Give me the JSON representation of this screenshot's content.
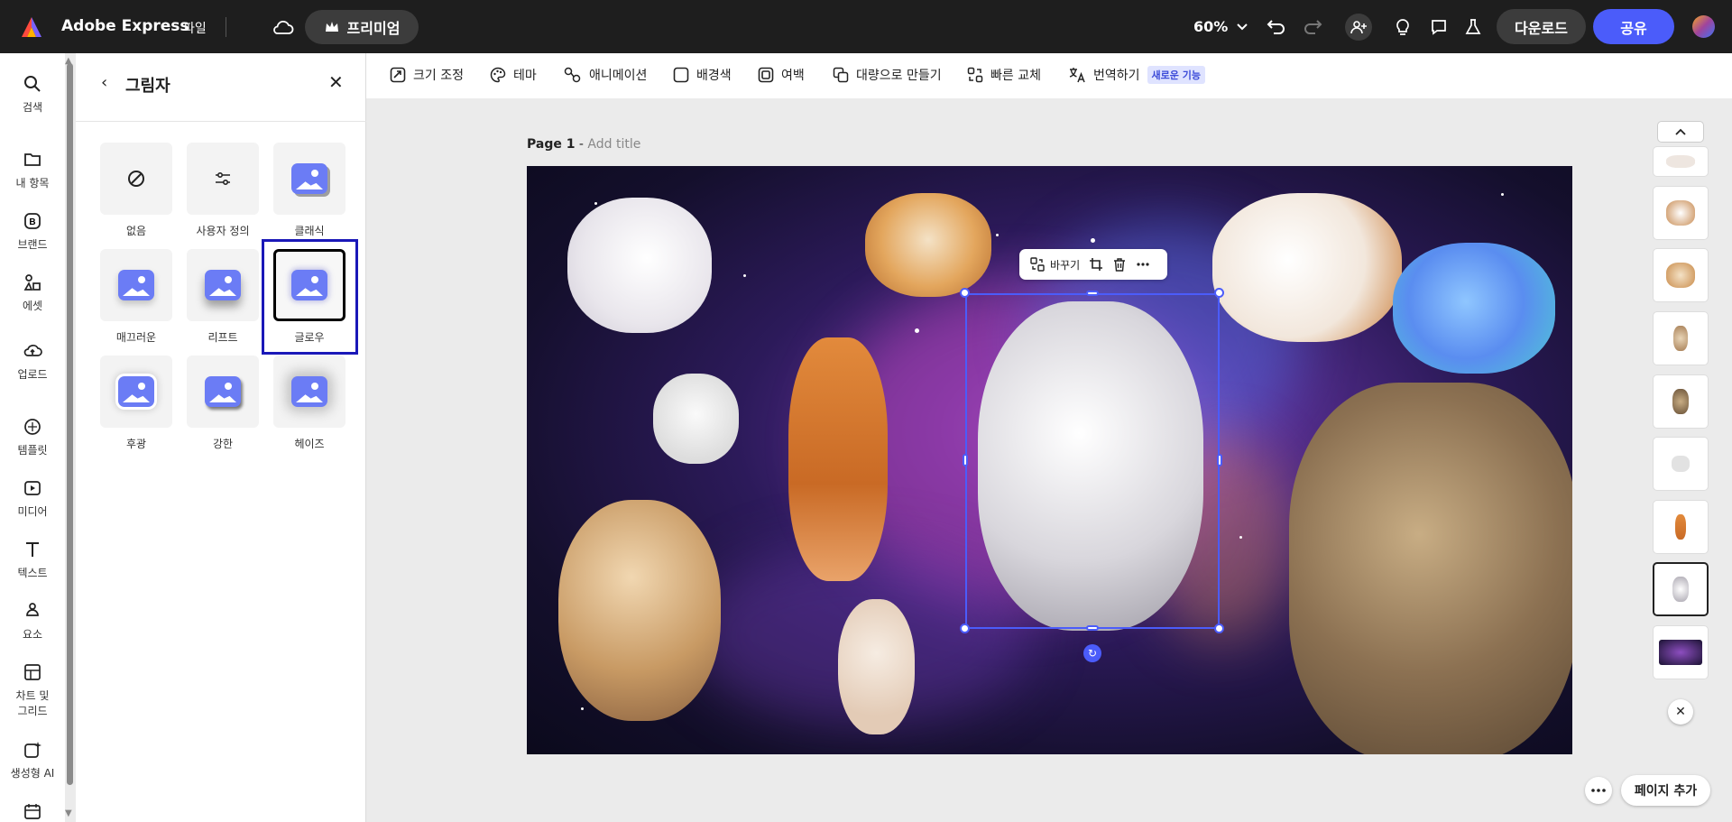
{
  "app": {
    "title": "Adobe Express",
    "file_menu": "파일",
    "premium_label": "프리미엄"
  },
  "topbar": {
    "zoom": "60%",
    "download_label": "다운로드",
    "share_label": "공유"
  },
  "rail": {
    "items": [
      {
        "label": "검색",
        "icon": "search-icon"
      },
      {
        "label": "내 항목",
        "icon": "folder-icon"
      },
      {
        "label": "브랜드",
        "icon": "brand-icon"
      },
      {
        "label": "에셋",
        "icon": "assets-icon"
      },
      {
        "label": "업로드",
        "icon": "upload-icon"
      },
      {
        "label": "템플릿",
        "icon": "template-icon"
      },
      {
        "label": "미디어",
        "icon": "media-icon"
      },
      {
        "label": "텍스트",
        "icon": "text-icon"
      },
      {
        "label": "요소",
        "icon": "elements-icon"
      },
      {
        "label": "차트 및",
        "label2": "그리드",
        "icon": "chart-grid-icon"
      },
      {
        "label": "생성형 AI",
        "icon": "ai-icon"
      }
    ]
  },
  "panel": {
    "title": "그림자",
    "options": [
      {
        "label": "없음"
      },
      {
        "label": "사용자 정의"
      },
      {
        "label": "클래식"
      },
      {
        "label": "매끄러운"
      },
      {
        "label": "리프트"
      },
      {
        "label": "글로우"
      },
      {
        "label": "후광"
      },
      {
        "label": "강한"
      },
      {
        "label": "헤이즈"
      }
    ],
    "selected": "글로우"
  },
  "toolbar": {
    "items": [
      {
        "label": "크기 조정",
        "icon": "resize-icon"
      },
      {
        "label": "테마",
        "icon": "palette-icon"
      },
      {
        "label": "애니메이션",
        "icon": "animation-icon"
      },
      {
        "label": "배경색",
        "icon": "background-color-icon"
      },
      {
        "label": "여백",
        "icon": "margin-icon"
      },
      {
        "label": "대량으로 만들기",
        "icon": "bulk-create-icon"
      },
      {
        "label": "빠른 교체",
        "icon": "quick-swap-icon"
      },
      {
        "label": "번역하기",
        "icon": "translate-icon"
      }
    ],
    "new_badge": "새로운 기능"
  },
  "page": {
    "name": "Page 1",
    "separator": " - ",
    "title_placeholder": "Add title"
  },
  "context_bar": {
    "replace_label": "바꾸기"
  },
  "bottom": {
    "add_page_label": "페이지 추가"
  },
  "colors": {
    "accent": "#4b5cfa",
    "topbar": "#1e1e1e",
    "selection_outline": "#1a18b8"
  }
}
